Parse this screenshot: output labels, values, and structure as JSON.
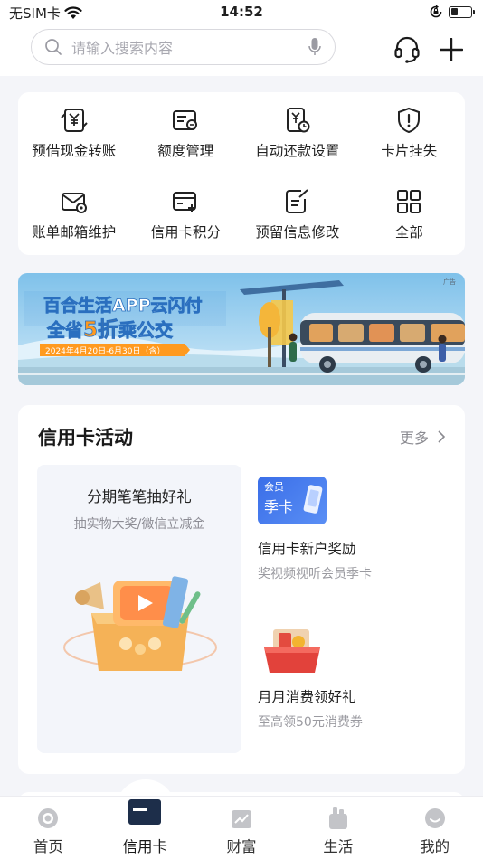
{
  "status_bar": {
    "carrier": "无SIM卡",
    "time": "14:52",
    "battery_level": 0.35
  },
  "search": {
    "placeholder": "请输入搜索内容"
  },
  "header_icons": [
    "headset-icon",
    "plus-icon"
  ],
  "quick_actions": [
    {
      "label": "预借现金转账",
      "icon": "cash-transfer-icon"
    },
    {
      "label": "额度管理",
      "icon": "credit-limit-icon"
    },
    {
      "label": "自动还款设置",
      "icon": "auto-repay-icon"
    },
    {
      "label": "卡片挂失",
      "icon": "shield-alert-icon"
    },
    {
      "label": "账单邮箱维护",
      "icon": "mail-settings-icon"
    },
    {
      "label": "信用卡积分",
      "icon": "card-points-icon"
    },
    {
      "label": "预留信息修改",
      "icon": "edit-doc-icon"
    },
    {
      "label": "全部",
      "icon": "grid-icon"
    }
  ],
  "banner": {
    "tag": "广告",
    "line1": "百合生活APP云闪付",
    "line2_pre": "全省",
    "line2_highlight": "5折",
    "line2_post": "乘公交",
    "date_range": "2024年4月20日-6月30日（含）",
    "colors": {
      "sky": "#9fd0ee",
      "accent": "#ff9a1f",
      "title": "#ffffff"
    }
  },
  "activities": {
    "title": "信用卡活动",
    "more_label": "更多",
    "featured": {
      "title": "分期笔笔抽好礼",
      "subtitle": "抽实物大奖/微信立减金"
    },
    "items": [
      {
        "badge_top": "会员",
        "badge_main": "季卡",
        "title": "信用卡新户奖励",
        "subtitle": "奖视频视听会员季卡"
      },
      {
        "title": "月月消费领好礼",
        "subtitle": "至高领50元消费券"
      }
    ]
  },
  "tabs": [
    {
      "label": "首页",
      "icon": "home-icon",
      "active": false
    },
    {
      "label": "信用卡",
      "icon": "credit-card-icon",
      "active": true
    },
    {
      "label": "财富",
      "icon": "wealth-chart-icon",
      "active": false
    },
    {
      "label": "生活",
      "icon": "life-bag-icon",
      "active": false
    },
    {
      "label": "我的",
      "icon": "profile-icon",
      "active": false
    }
  ]
}
